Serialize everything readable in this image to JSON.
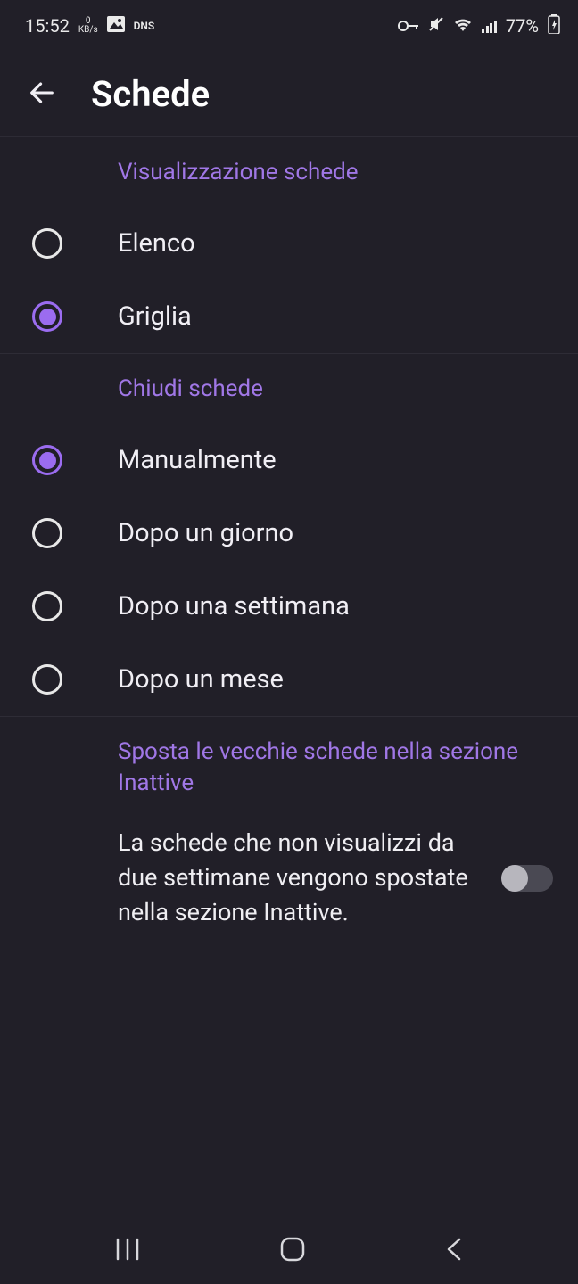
{
  "status": {
    "time": "15:52",
    "speed_top": "0",
    "speed_bottom": "KB/s",
    "dns": "DNS",
    "battery": "77%"
  },
  "header": {
    "title": "Schede"
  },
  "sections": {
    "view": {
      "title": "Visualizzazione schede",
      "options": [
        {
          "label": "Elenco",
          "selected": false
        },
        {
          "label": "Griglia",
          "selected": true
        }
      ]
    },
    "close": {
      "title": "Chiudi schede",
      "options": [
        {
          "label": "Manualmente",
          "selected": true
        },
        {
          "label": "Dopo un giorno",
          "selected": false
        },
        {
          "label": "Dopo una settimana",
          "selected": false
        },
        {
          "label": "Dopo un mese",
          "selected": false
        }
      ]
    },
    "inactive": {
      "title": "Sposta le vecchie schede nella sezione Inattive",
      "description": "La schede che non visualizzi da due settimane vengono spostate nella sezione Inattive.",
      "enabled": false
    }
  }
}
